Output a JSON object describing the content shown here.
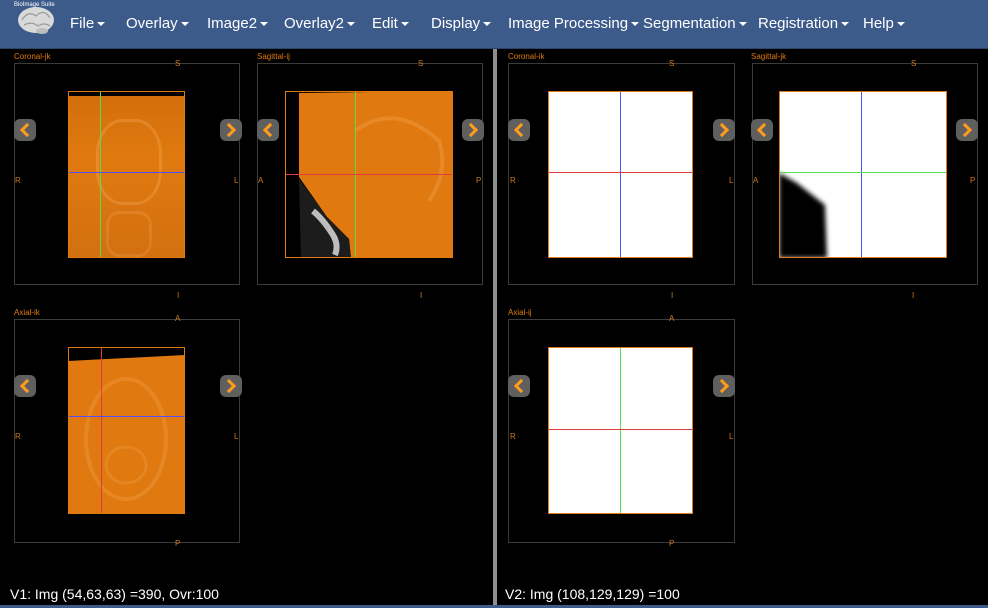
{
  "app": {
    "logo_text": "BioImage Suite",
    "menu": [
      {
        "label": "File"
      },
      {
        "label": "Overlay"
      },
      {
        "label": "Image2"
      },
      {
        "label": "Overlay2"
      },
      {
        "label": "Edit"
      },
      {
        "label": "Display"
      },
      {
        "label": "Image Processing"
      },
      {
        "label": "Segmentation"
      },
      {
        "label": "Registration"
      },
      {
        "label": "Help"
      }
    ]
  },
  "viewer1": {
    "coronal": {
      "title": "Coronal-jk",
      "top": "S",
      "bottom": "I",
      "left": "R",
      "right": "L"
    },
    "sagittal": {
      "title": "Sagittal-ij",
      "top": "S",
      "bottom": "I",
      "left": "A",
      "right": "P"
    },
    "axial": {
      "title": "Axial-ik",
      "top": "A",
      "bottom": "P",
      "left": "R",
      "right": "L"
    },
    "status": "V1: Img (54,63,63) =390, Ovr:100"
  },
  "viewer2": {
    "coronal": {
      "title": "Coronal-ik",
      "top": "S",
      "bottom": "I",
      "left": "R",
      "right": "L"
    },
    "sagittal": {
      "title": "Sagittal-jk",
      "top": "S",
      "bottom": "I",
      "left": "A",
      "right": "P"
    },
    "axial": {
      "title": "Axial-ij",
      "top": "A",
      "bottom": "P",
      "left": "R",
      "right": "L"
    },
    "status": "V2: Img (108,129,129) =100"
  },
  "colors": {
    "nav_bg": "#3c5a8a",
    "overlay_orange": "#e07a10",
    "crosshair_red": "#e23b3b",
    "crosshair_green": "#52e052",
    "crosshair_blue": "#5050ff"
  },
  "icons": {
    "prev": "chevron-left-icon",
    "next": "chevron-right-icon"
  }
}
